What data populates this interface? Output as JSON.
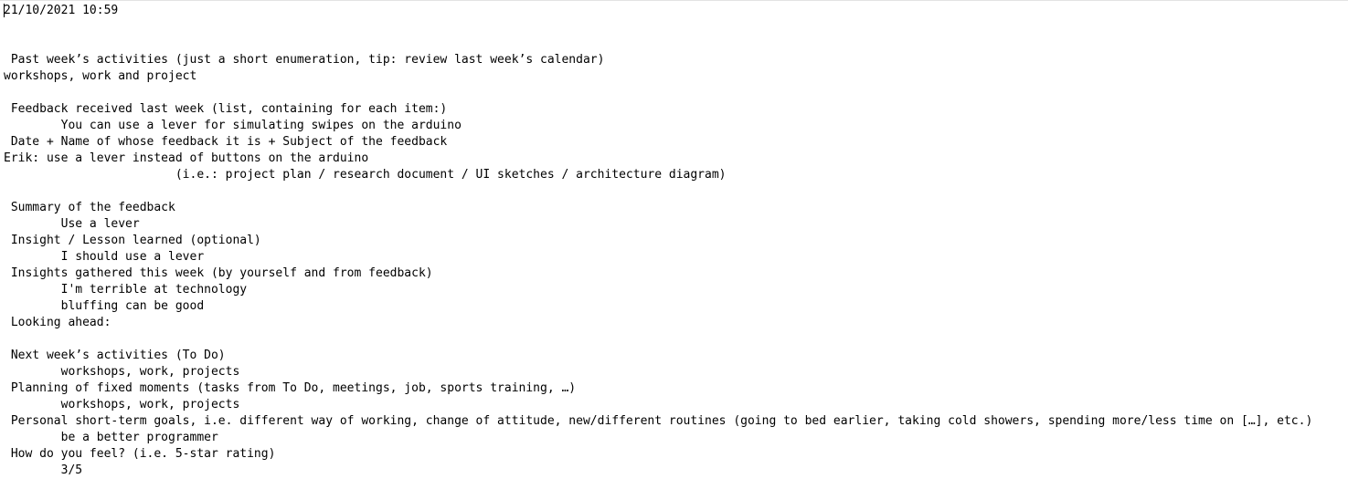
{
  "document": {
    "lines": [
      "21/10/2021 10:59",
      "",
      "",
      " Past week’s activities (just a short enumeration, tip: review last week’s calendar)",
      "workshops, work and project",
      "",
      " Feedback received last week (list, containing for each item:)",
      "        You can use a lever for simulating swipes on the arduino",
      " Date + Name of whose feedback it is + Subject of the feedback",
      "Erik: use a lever instead of buttons on the arduino",
      "                        (i.e.: project plan / research document / UI sketches / architecture diagram)",
      "",
      " Summary of the feedback",
      "        Use a lever",
      " Insight / Lesson learned (optional)",
      "        I should use a lever",
      " Insights gathered this week (by yourself and from feedback)",
      "        I'm terrible at technology",
      "        bluffing can be good",
      " Looking ahead:",
      "",
      " Next week’s activities (To Do)",
      "        workshops, work, projects",
      " Planning of fixed moments (tasks from To Do, meetings, job, sports training, …)",
      "        workshops, work, projects",
      " Personal short-term goals, i.e. different way of working, change of attitude, new/different routines (going to bed earlier, taking cold showers, spending more/less time on […], etc.)",
      "        be a better programmer",
      " How do you feel? (i.e. 5-star rating)",
      "        3/5"
    ]
  }
}
